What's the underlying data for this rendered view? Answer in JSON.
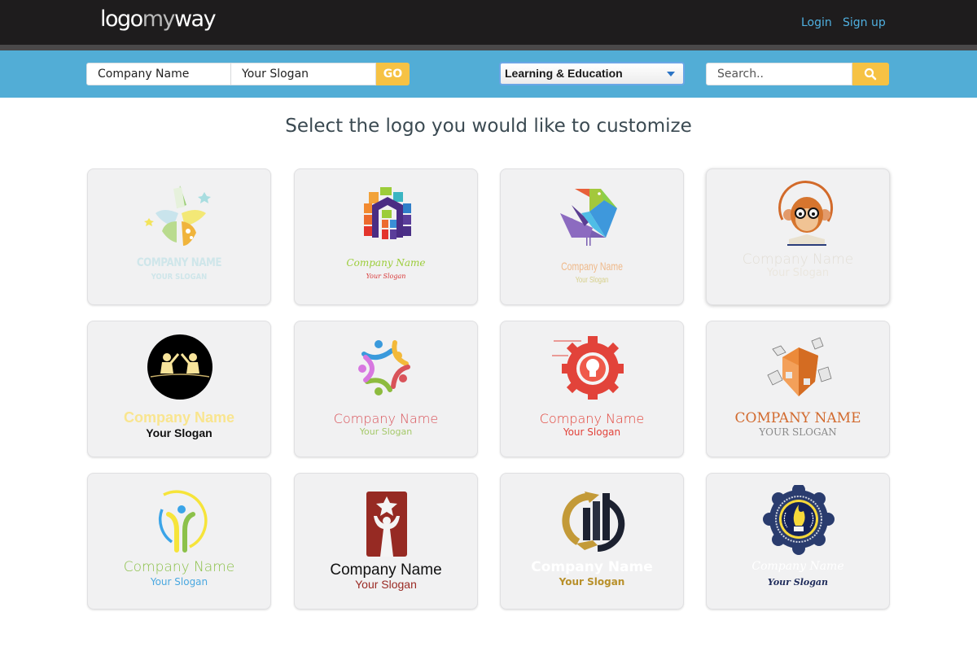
{
  "header": {
    "brand_part1": "logo",
    "brand_part2": "my",
    "brand_part3": "way",
    "login_label": "Login",
    "signup_label": "Sign up"
  },
  "toolbar": {
    "company_name_value": "Company Name",
    "slogan_value": "Your Slogan",
    "go_label": "GO",
    "category_selected": "Learning & Education",
    "search_placeholder": "Search..",
    "accent_color": "#f6c244",
    "bar_color": "#52add6"
  },
  "main": {
    "heading": "Select the logo you would like to customize"
  },
  "logos": [
    {
      "icon": "star-rocket-icon",
      "name": "COMPANY NAME",
      "slogan": "YOUR SLOGAN",
      "name_color": "#cfe6ea",
      "slogan_color": "#cfe6ea"
    },
    {
      "icon": "rainbow-cube-icon",
      "name": "Company Name",
      "slogan": "Your Slogan",
      "name_color": "#9ccd3a",
      "slogan_color": "#d93a3a"
    },
    {
      "icon": "origami-bird-icon",
      "name": "Company Name",
      "slogan": "Your Slogan",
      "name_color": "#efb98a",
      "slogan_color": "#d6d08a"
    },
    {
      "icon": "monkey-reading-icon",
      "name": "Company Name",
      "slogan": "Your Slogan",
      "name_color": "#e2ded6",
      "slogan_color": "#ebe7df"
    },
    {
      "icon": "high-five-kids-icon",
      "name": "Company Name",
      "slogan": "Your Slogan",
      "name_color": "#f9e58f",
      "slogan_color": "#111111"
    },
    {
      "icon": "people-star-icon",
      "name": "Company Name",
      "slogan": "Your Slogan",
      "name_color": "#d9535a",
      "slogan_color": "#a5c96a"
    },
    {
      "icon": "gear-bulb-icon",
      "name": "Company Name",
      "slogan": "Your Slogan",
      "name_color": "#e2433a",
      "slogan_color": "#e2433a"
    },
    {
      "icon": "orange-cubes-icon",
      "name": "COMPANY NAME",
      "slogan": "YOUR SLOGAN",
      "name_color": "#d26a2e",
      "slogan_color": "#8a8a8a"
    },
    {
      "icon": "person-circle-icon",
      "name": "Company Name",
      "slogan": "Your Slogan",
      "name_color": "#8cc14a",
      "slogan_color": "#4aa8e0"
    },
    {
      "icon": "star-trophy-person-icon",
      "name": "Company Name",
      "slogan": "Your Slogan",
      "name_color": "#111111",
      "slogan_color": "#9a2a24"
    },
    {
      "icon": "growth-chart-handshake-icon",
      "name": "Company Name",
      "slogan": "Your Slogan",
      "name_color": "#ffffff",
      "slogan_color": "#b8902a"
    },
    {
      "icon": "torch-badge-icon",
      "name": "Company Name",
      "slogan": "Your Slogan",
      "name_color": "#ffffff",
      "slogan_color": "#1d2a5a"
    }
  ]
}
